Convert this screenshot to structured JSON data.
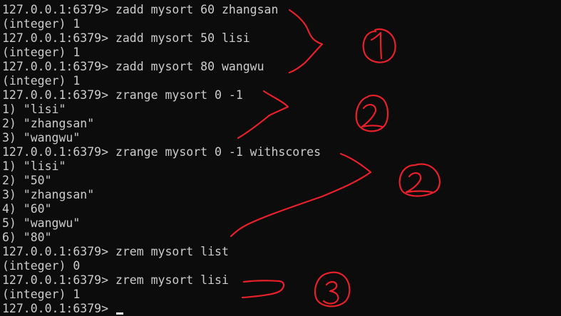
{
  "terminal": {
    "lines": [
      "127.0.0.1:6379> zadd mysort 60 zhangsan",
      "(integer) 1",
      "127.0.0.1:6379> zadd mysort 50 lisi",
      "(integer) 1",
      "127.0.0.1:6379> zadd mysort 80 wangwu",
      "(integer) 1",
      "127.0.0.1:6379> zrange mysort 0 -1",
      "1) \"lisi\"",
      "2) \"zhangsan\"",
      "3) \"wangwu\"",
      "127.0.0.1:6379> zrange mysort 0 -1 withscores",
      "1) \"lisi\"",
      "2) \"50\"",
      "3) \"zhangsan\"",
      "4) \"60\"",
      "5) \"wangwu\"",
      "6) \"80\"",
      "127.0.0.1:6379> zrem mysort list",
      "(integer) 0",
      "127.0.0.1:6379> zrem mysort lisi",
      "(integer) 1"
    ],
    "prompt": "127.0.0.1:6379> ",
    "colors": {
      "background": "#0c0c0c",
      "text": "#cccccc",
      "annotation": "#e8202a"
    }
  },
  "annotations": [
    {
      "label": "1",
      "name": "annotation-group-1"
    },
    {
      "label": "2",
      "name": "annotation-group-2"
    },
    {
      "label": "2",
      "name": "annotation-group-3"
    },
    {
      "label": "3",
      "name": "annotation-group-4"
    }
  ]
}
